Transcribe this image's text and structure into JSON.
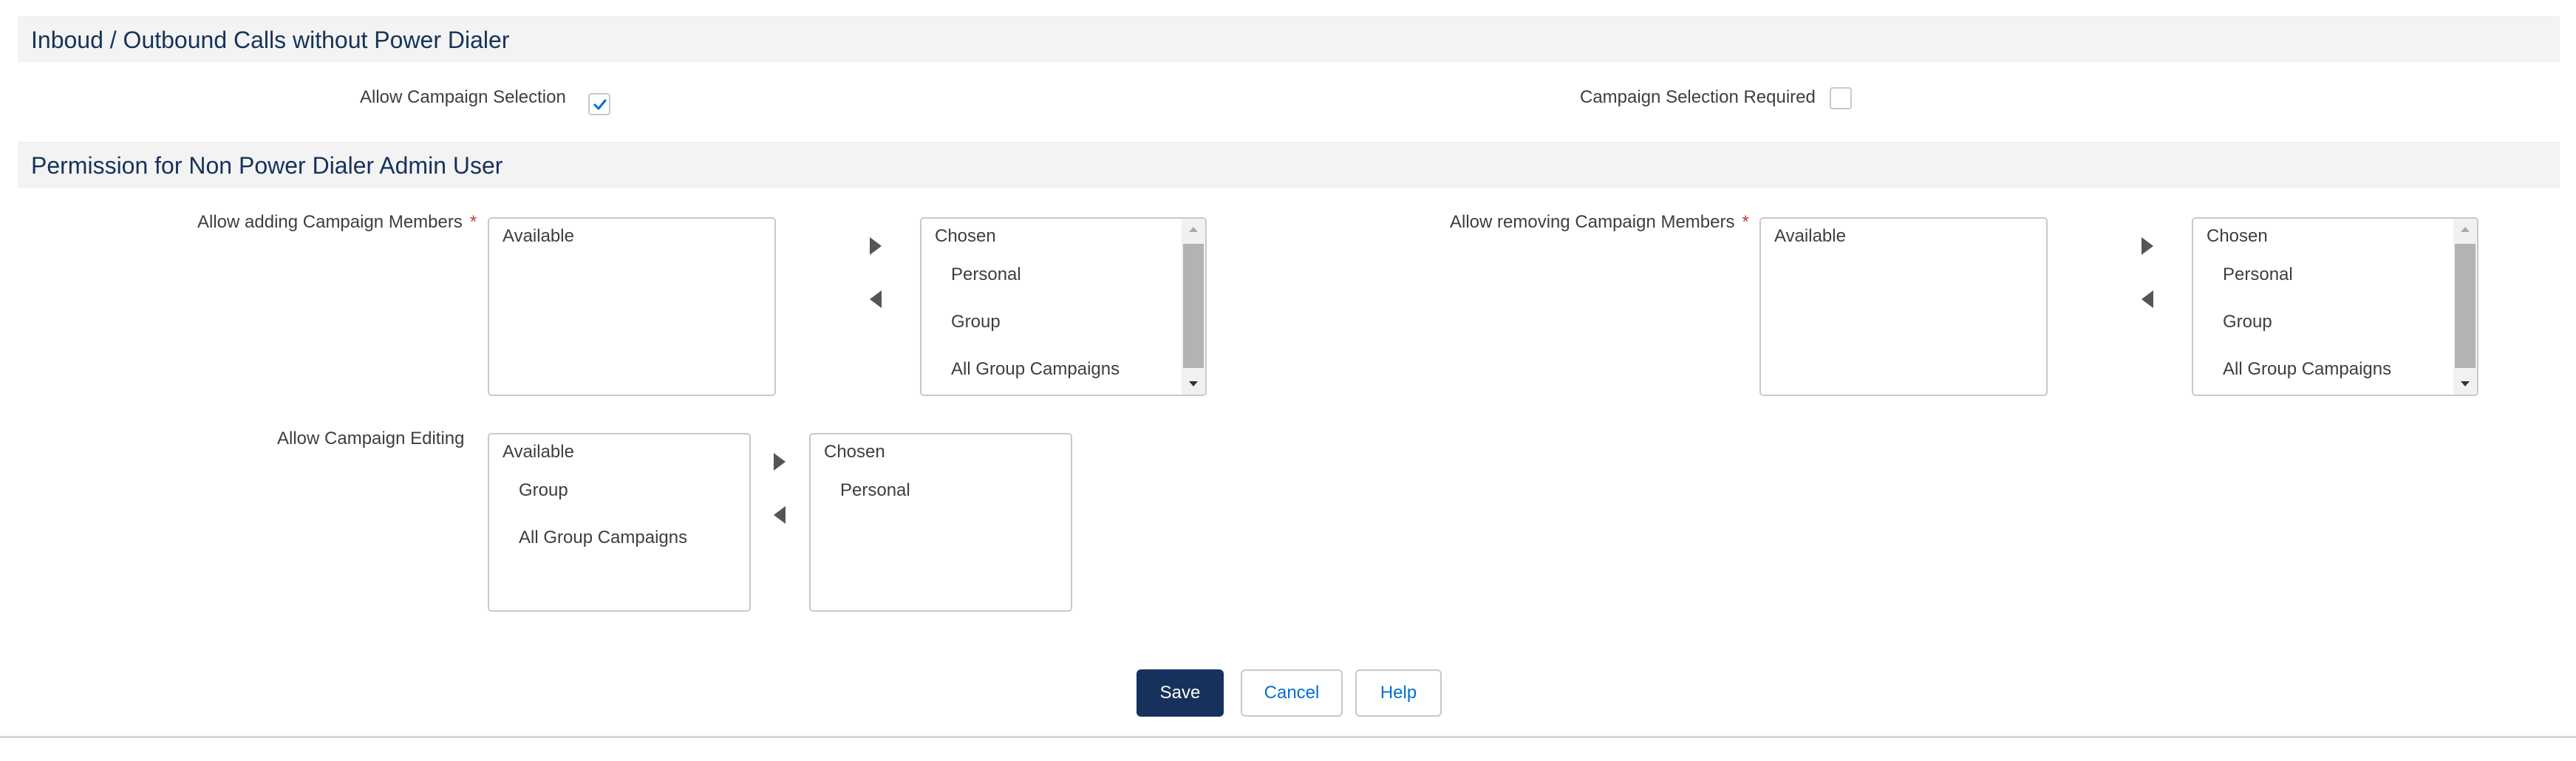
{
  "sections": {
    "inbound": {
      "title": "Inboud / Outbound Calls without Power Dialer"
    },
    "permission": {
      "title": "Permission for Non Power Dialer Admin User"
    }
  },
  "fields": {
    "allow_campaign_selection": {
      "label": "Allow Campaign Selection",
      "checked": true
    },
    "campaign_selection_required": {
      "label": "Campaign Selection Required",
      "checked": false
    }
  },
  "dual_lists": {
    "adding": {
      "label": "Allow adding Campaign Members",
      "required_mark": "*",
      "available_title": "Available",
      "available_items": [],
      "chosen_title": "Chosen",
      "chosen_items": [
        "Personal",
        "Group",
        "All Group Campaigns"
      ]
    },
    "removing": {
      "label": "Allow removing Campaign Members",
      "required_mark": "*",
      "available_title": "Available",
      "available_items": [],
      "chosen_title": "Chosen",
      "chosen_items": [
        "Personal",
        "Group",
        "All Group Campaigns"
      ]
    },
    "editing": {
      "label": "Allow Campaign Editing",
      "available_title": "Available",
      "available_items": [
        "Group",
        "All Group Campaigns"
      ],
      "chosen_title": "Chosen",
      "chosen_items": [
        "Personal"
      ]
    }
  },
  "buttons": {
    "save": "Save",
    "cancel": "Cancel",
    "help": "Help"
  },
  "colors": {
    "primary": "#16325c",
    "link": "#0070d2",
    "required": "#c23934",
    "header_bg": "#f3f3f3"
  }
}
